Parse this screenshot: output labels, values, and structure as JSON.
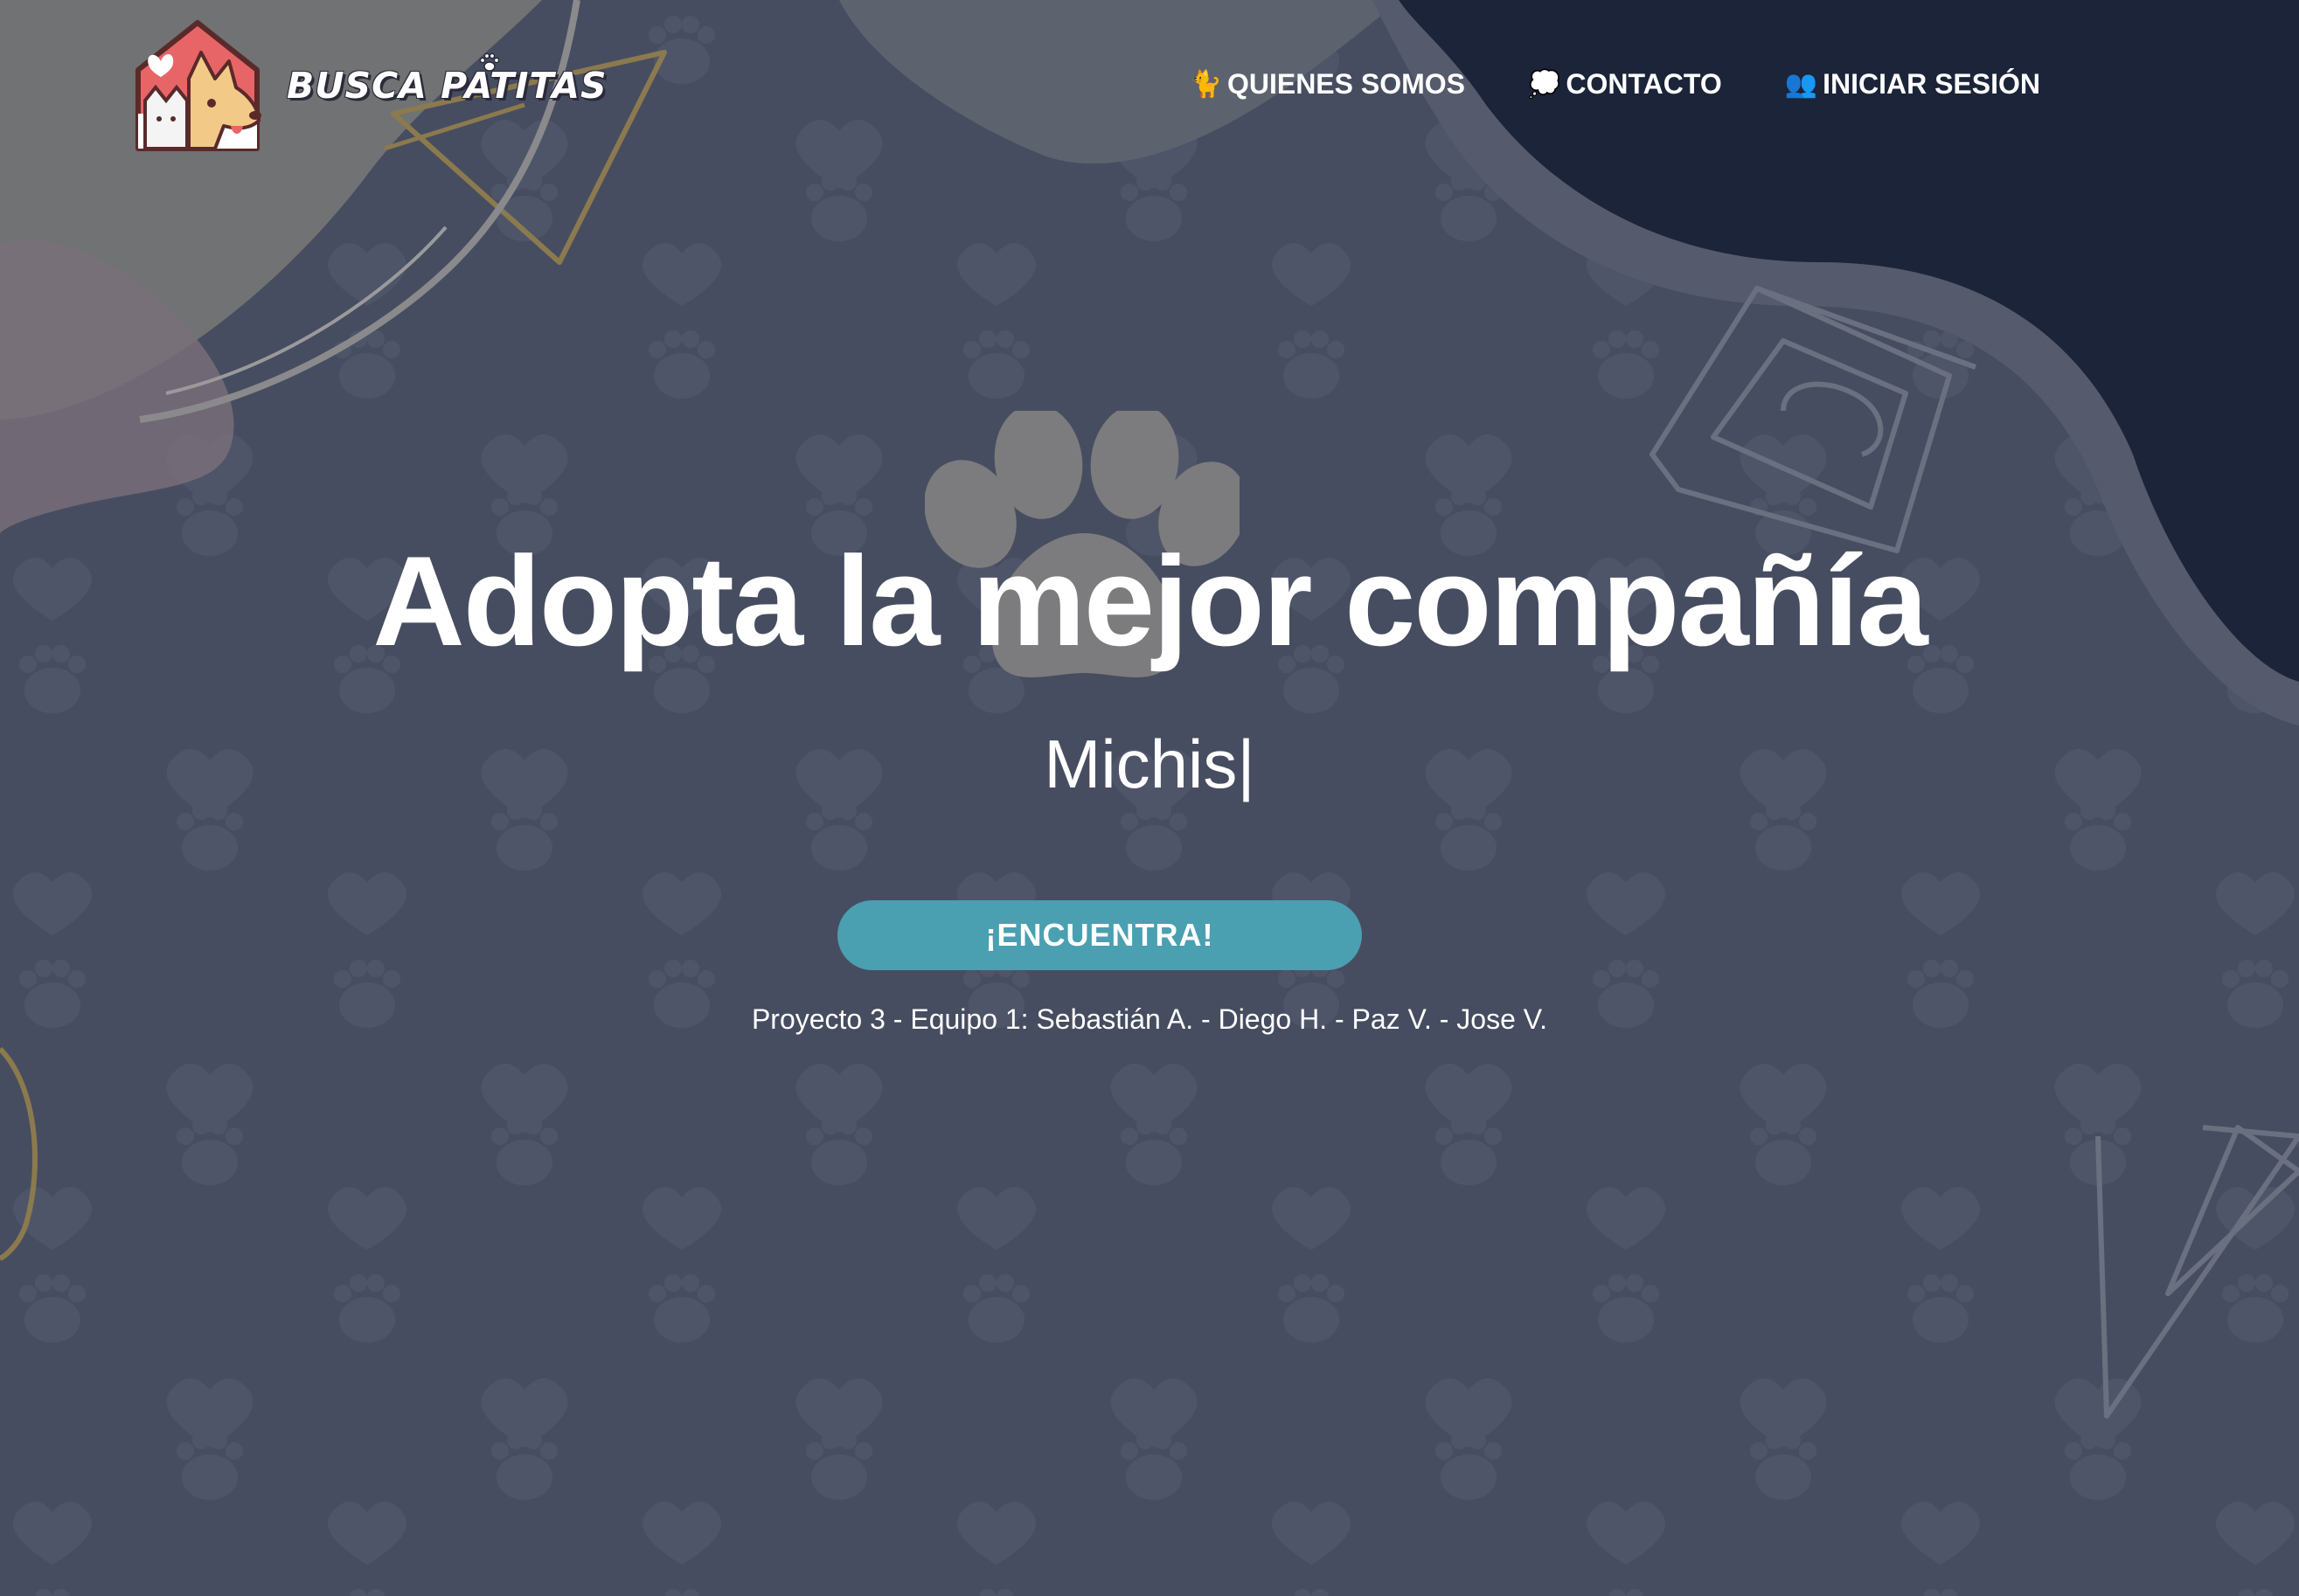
{
  "header": {
    "brand": "BUSCA PATITAS",
    "logo_icon": "cat-dog-house-logo",
    "nav": [
      {
        "icon": "🐈",
        "icon_name": "cat-icon",
        "label": "QUIENES SOMOS"
      },
      {
        "icon": "💭",
        "icon_name": "thought-bubble-icon",
        "label": "CONTACTO"
      },
      {
        "icon": "👥",
        "icon_name": "users-icon",
        "label": "INICIAR SESIÓN"
      }
    ]
  },
  "hero": {
    "title": "Adopta la mejor compañía",
    "typed_word": "Michis",
    "caret": "|",
    "cta_label": "¡ENCUENTRA!",
    "credits": "Proyecto 3 - Equipo 1: Sebastián A. - Diego H. - Paz V. - Jose V."
  },
  "colors": {
    "background": "#474d60",
    "dark_corner": "#1b2438",
    "cta": "#4a9fb1",
    "text": "#ffffff"
  }
}
